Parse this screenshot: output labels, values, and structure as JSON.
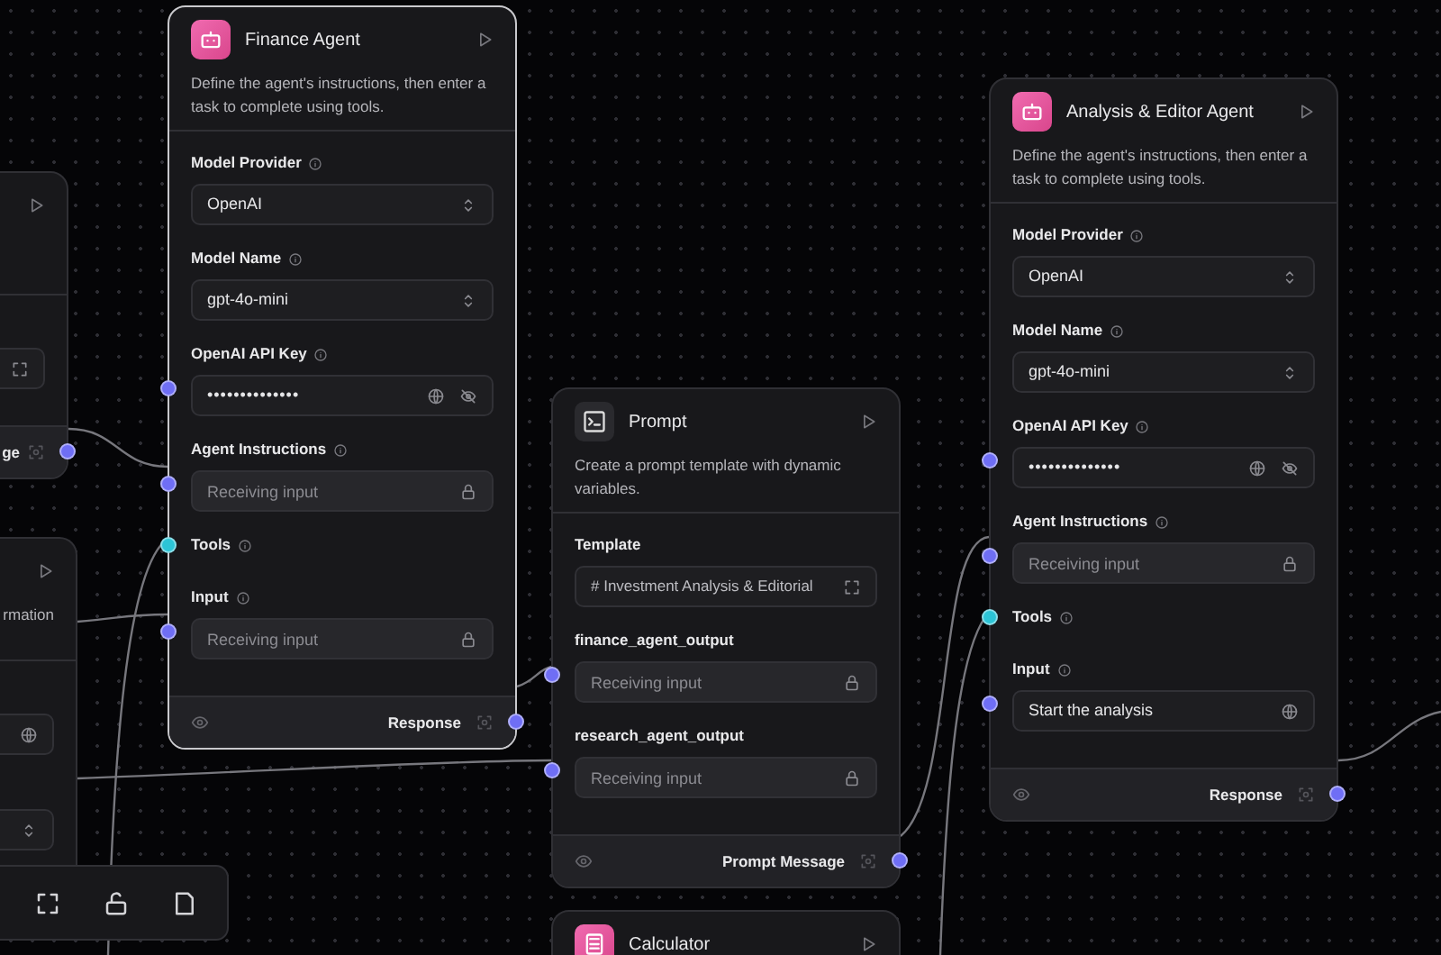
{
  "nodes": [
    {
      "kind": "partial",
      "selected": false,
      "fields": [
        {
          "kind": "expand"
        }
      ],
      "footer": {
        "output": "ge",
        "handle": {
          "color": "#6f6ef5"
        }
      }
    },
    {
      "kind": "partial",
      "selected": false,
      "description": "rmation",
      "fields": [
        {
          "kind": "globe"
        },
        {
          "kind": "select"
        }
      ]
    },
    {
      "kind": "agent",
      "selected": true,
      "title": "Finance Agent",
      "description": "Define the agent's instructions, then enter a task to complete using tools.",
      "fields": [
        {
          "kind": "select",
          "label": "Model Provider",
          "info": true,
          "value": "OpenAI"
        },
        {
          "kind": "select",
          "label": "Model Name",
          "info": true,
          "value": "gpt-4o-mini"
        },
        {
          "kind": "password",
          "label": "OpenAI API Key",
          "info": true,
          "value": "••••••••••••••",
          "handle": {
            "color": "#6f6ef5"
          }
        },
        {
          "kind": "locked",
          "label": "Agent Instructions",
          "info": true,
          "placeholder": "Receiving input",
          "handle": {
            "color": "#6f6ef5"
          }
        },
        {
          "kind": "none",
          "label": "Tools",
          "info": true,
          "handle": {
            "color": "#2cc4d6"
          }
        },
        {
          "kind": "locked",
          "label": "Input",
          "info": true,
          "placeholder": "Receiving input",
          "handle": {
            "color": "#6f6ef5"
          }
        }
      ],
      "footer": {
        "output": "Response",
        "handle": {
          "color": "#6f6ef5"
        }
      }
    },
    {
      "kind": "prompt",
      "selected": false,
      "title": "Prompt",
      "description": "Create a prompt template with dynamic variables.",
      "fields": [
        {
          "kind": "template",
          "label": "Template",
          "info": false,
          "value": "# Investment Analysis & Editorial"
        },
        {
          "kind": "locked",
          "label": "finance_agent_output",
          "info": false,
          "placeholder": "Receiving input",
          "handle": {
            "color": "#6f6ef5"
          }
        },
        {
          "kind": "locked",
          "label": "research_agent_output",
          "info": false,
          "placeholder": "Receiving input",
          "handle": {
            "color": "#6f6ef5"
          }
        }
      ],
      "footer": {
        "output": "Prompt Message",
        "handle": {
          "color": "#6f6ef5"
        }
      }
    },
    {
      "kind": "tool",
      "selected": false,
      "title": "Calculator"
    },
    {
      "kind": "agent",
      "selected": false,
      "title": "Analysis & Editor Agent",
      "description": "Define the agent's instructions, then enter a task to complete using tools.",
      "fields": [
        {
          "kind": "select",
          "label": "Model Provider",
          "info": true,
          "value": "OpenAI"
        },
        {
          "kind": "select",
          "label": "Model Name",
          "info": true,
          "value": "gpt-4o-mini"
        },
        {
          "kind": "password",
          "label": "OpenAI API Key",
          "info": true,
          "value": "••••••••••••••",
          "handle": {
            "color": "#6f6ef5"
          }
        },
        {
          "kind": "locked",
          "label": "Agent Instructions",
          "info": true,
          "placeholder": "Receiving input",
          "handle": {
            "color": "#6f6ef5"
          }
        },
        {
          "kind": "none",
          "label": "Tools",
          "info": true,
          "handle": {
            "color": "#2cc4d6"
          }
        },
        {
          "kind": "text",
          "label": "Input",
          "info": true,
          "value": "Start the analysis",
          "handle": {
            "color": "#6f6ef5"
          }
        }
      ],
      "footer": {
        "output": "Response",
        "handle": {
          "color": "#6f6ef5"
        }
      }
    }
  ]
}
